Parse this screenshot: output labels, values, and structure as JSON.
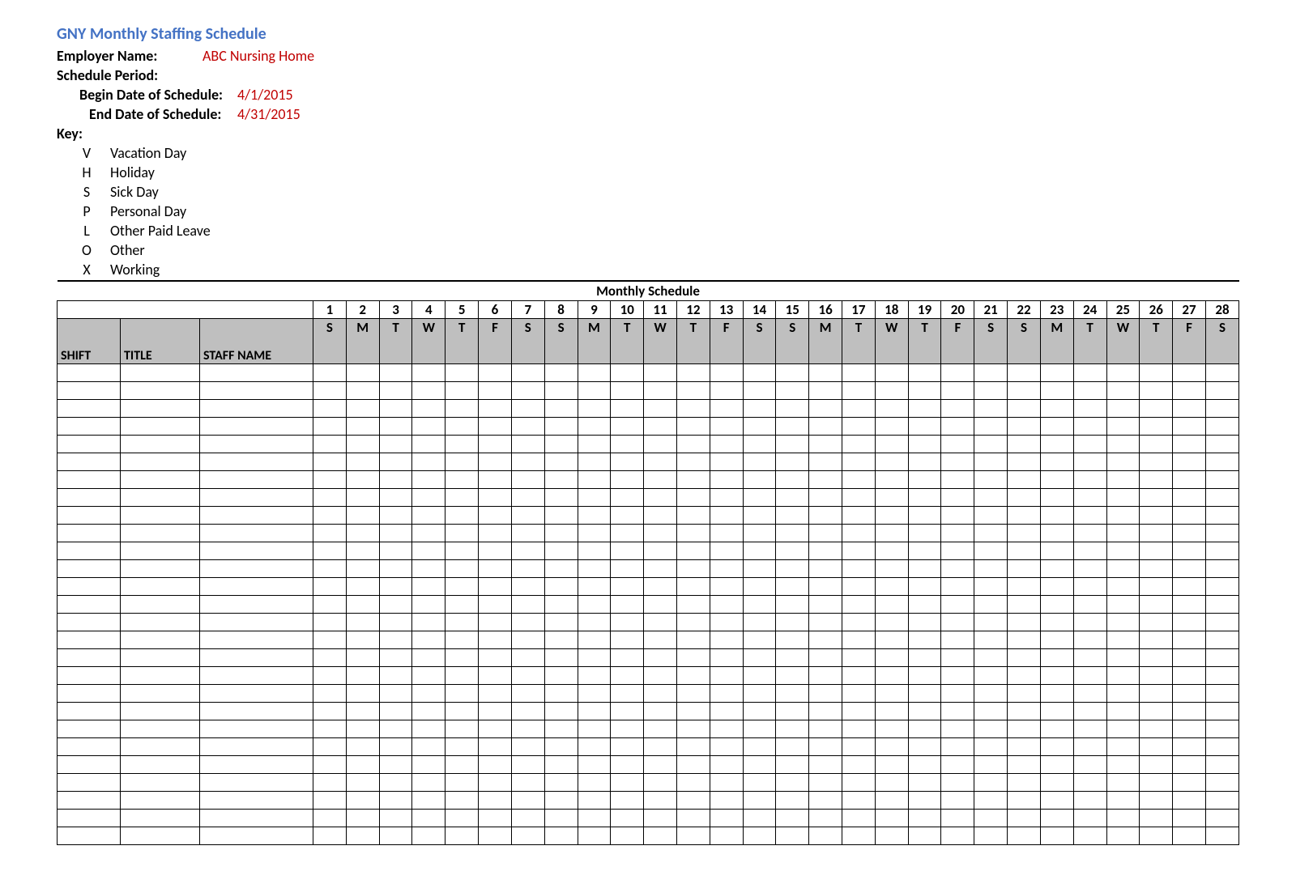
{
  "title": "GNY Monthly Staffing Schedule",
  "header": {
    "employer_label": "Employer Name:",
    "employer_value": "ABC Nursing Home",
    "period_label": "Schedule Period:",
    "begin_label": "Begin Date of Schedule:",
    "begin_value": "4/1/2015",
    "end_label": "End Date of Schedule:",
    "end_value": "4/31/2015"
  },
  "key_label": "Key:",
  "key": [
    {
      "code": "V",
      "desc": "Vacation Day"
    },
    {
      "code": "H",
      "desc": "Holiday"
    },
    {
      "code": "S",
      "desc": "Sick Day"
    },
    {
      "code": "P",
      "desc": "Personal Day"
    },
    {
      "code": "L",
      "desc": "Other Paid Leave"
    },
    {
      "code": "O",
      "desc": "Other"
    },
    {
      "code": "X",
      "desc": "Working"
    }
  ],
  "table": {
    "banner": "Monthly Schedule",
    "col_shift": "SHIFT",
    "col_title": "TITLE",
    "col_name": "STAFF NAME",
    "days": [
      "1",
      "2",
      "3",
      "4",
      "5",
      "6",
      "7",
      "8",
      "9",
      "10",
      "11",
      "12",
      "13",
      "14",
      "15",
      "16",
      "17",
      "18",
      "19",
      "20",
      "21",
      "22",
      "23",
      "24",
      "25",
      "26",
      "27",
      "28"
    ],
    "dow": [
      "S",
      "M",
      "T",
      "W",
      "T",
      "F",
      "S",
      "S",
      "M",
      "T",
      "W",
      "T",
      "F",
      "S",
      "S",
      "M",
      "T",
      "W",
      "T",
      "F",
      "S",
      "S",
      "M",
      "T",
      "W",
      "T",
      "F",
      "S"
    ],
    "row_count": 27
  }
}
